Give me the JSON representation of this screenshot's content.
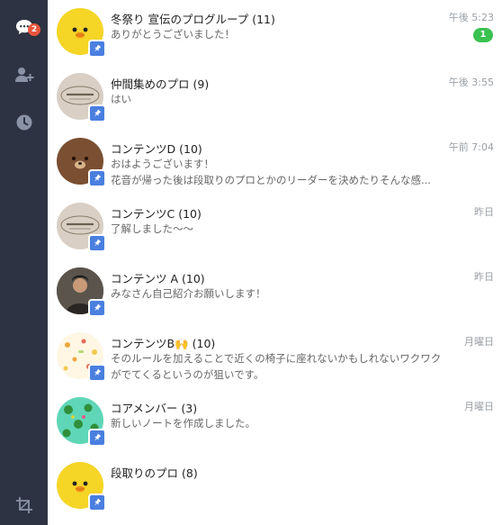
{
  "rail": {
    "chat_badge": "2",
    "colors": {
      "background": "#2d3342",
      "icon_active": "#ffffff",
      "icon_inactive": "#8a93a6",
      "badge": "#e8553c"
    }
  },
  "chats": [
    {
      "name": "冬祭り 宣伝のプログループ",
      "count": "(11)",
      "preview": "ありがとうございました！",
      "time": "午後 5:23",
      "unread": "1",
      "avatar": "sally-chick-yellow"
    },
    {
      "name": "仲間集めのプロ",
      "count": "(9)",
      "preview": "はい",
      "time": "午後 3:55",
      "avatar": "lab-logo"
    },
    {
      "name": "コンテンツD",
      "count": "(10)",
      "preview": "おはようございます！\n花音が帰った後は段取りのプロとかのリーダーを決めたりそんな感...",
      "time": "午前 7:04",
      "avatar": "brown-bear"
    },
    {
      "name": "コンテンツC",
      "count": "(10)",
      "preview": "了解しました〜〜",
      "time": "昨日",
      "avatar": "lab-logo"
    },
    {
      "name": "コンテンツ A",
      "count": "(10)",
      "preview": "みなさん自己紹介お願いします！",
      "time": "昨日",
      "avatar": "person-photo"
    },
    {
      "name": "コンテンツB🙌",
      "count": "(10)",
      "preview": "そのルールを加えることで近くの椅子に座れないかもしれないワクワクがでてくるというのが狙いです。",
      "time": "月曜日",
      "avatar": "pattern"
    },
    {
      "name": "コアメンバー",
      "count": "(3)",
      "preview": "新しいノートを作成しました。",
      "time": "月曜日",
      "avatar": "frog-pattern"
    },
    {
      "name": "段取りのプロ",
      "count": "(8)",
      "preview": "",
      "time": "",
      "avatar": "sally-chick-yellow"
    }
  ],
  "colors": {
    "unread_badge": "#39c250",
    "pin_badge": "#4a7fe0",
    "time_text": "#9aa0a6"
  }
}
